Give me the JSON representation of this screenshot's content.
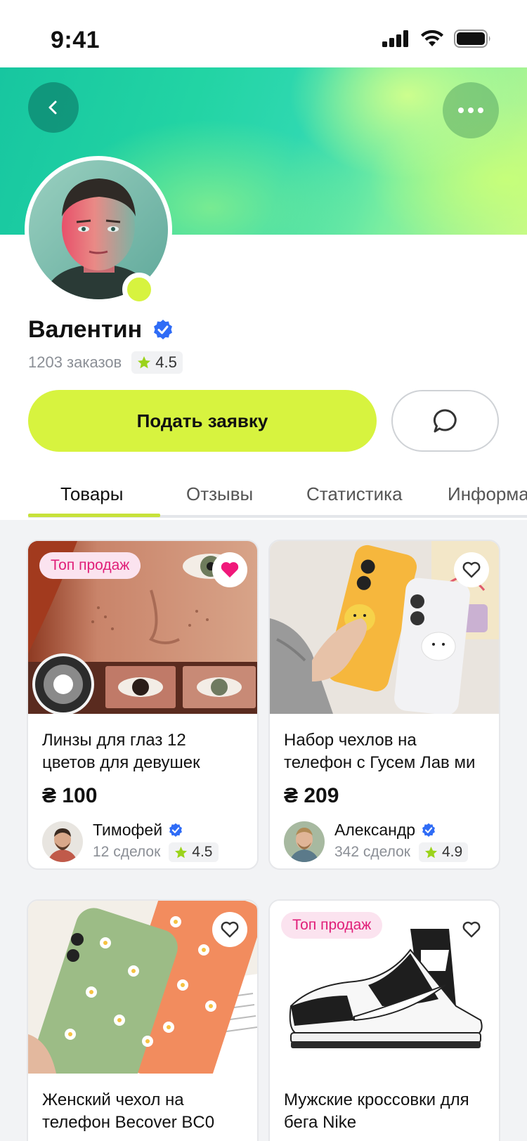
{
  "status": {
    "time": "9:41"
  },
  "profile": {
    "name": "Валентин",
    "orders": "1203 заказов",
    "rating": "4.5",
    "apply_label": "Подать заявку"
  },
  "tabs": [
    {
      "label": "Товары",
      "active": true
    },
    {
      "label": "Отзывы",
      "active": false
    },
    {
      "label": "Статистика",
      "active": false
    },
    {
      "label": "Информа",
      "active": false
    }
  ],
  "products": [
    {
      "badge": "Топ продаж",
      "favorite": true,
      "title": "Линзы для глаз 12 цветов для девушек",
      "price": "₴ 100",
      "seller": {
        "name": "Тимофей",
        "deals": "12 сделок",
        "rating": "4.5"
      }
    },
    {
      "badge": "",
      "favorite": false,
      "title": "Набор чехлов на телефон с Гусем Лав ми",
      "price": "₴ 209",
      "seller": {
        "name": "Александр",
        "deals": "342 сделок",
        "rating": "4.9"
      }
    },
    {
      "badge": "",
      "favorite": false,
      "title": "Женский чехол на телефон Becover BC0",
      "price": "",
      "seller": null
    },
    {
      "badge": "Топ продаж",
      "favorite": false,
      "title": "Мужские кроссовки для бега Nike",
      "price": "",
      "seller": null
    }
  ],
  "colors": {
    "accent": "#d7f33f",
    "badge_text": "#e01e78",
    "badge_bg": "#fbe3ef",
    "verified": "#2f6cf6",
    "star": "#9bd31a",
    "favorite": "#f0187a"
  }
}
